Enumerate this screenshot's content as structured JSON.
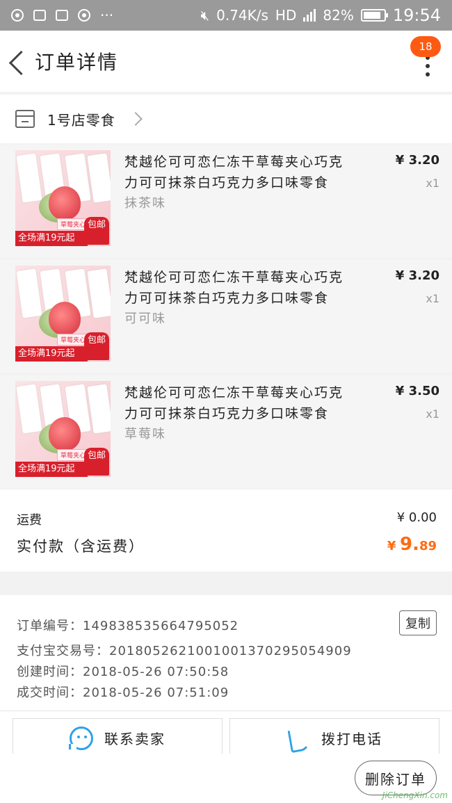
{
  "status_bar": {
    "network_speed": "0.74K/s",
    "network_type": "HD",
    "battery_pct": "82%",
    "time": "19:54"
  },
  "header": {
    "title": "订单详情",
    "badge_count": "18"
  },
  "store": {
    "name": "1号店零食"
  },
  "items": [
    {
      "title": "梵越伦可可恋仁冻干草莓夹心巧克力可可抹茶白巧克力多口味零食",
      "variant": "抹茶味",
      "price": "¥ 3.20",
      "qty": "x1",
      "thumb_tag": "草莓夹心巧克力",
      "thumb_promo": "全场满19元起",
      "thumb_ship": "包邮"
    },
    {
      "title": "梵越伦可可恋仁冻干草莓夹心巧克力可可抹茶白巧克力多口味零食",
      "variant": "可可味",
      "price": "¥ 3.20",
      "qty": "x1",
      "thumb_tag": "草莓夹心巧克力",
      "thumb_promo": "全场满19元起",
      "thumb_ship": "包邮"
    },
    {
      "title": "梵越伦可可恋仁冻干草莓夹心巧克力可可抹茶白巧克力多口味零食",
      "variant": "草莓味",
      "price": "¥ 3.50",
      "qty": "x1",
      "thumb_tag": "草莓夹心巧克力",
      "thumb_promo": "全场满19元起",
      "thumb_ship": "包邮"
    }
  ],
  "totals": {
    "shipping_label": "运费",
    "shipping_value": "¥ 0.00",
    "paid_label": "实付款（含运费）",
    "paid_currency": "¥",
    "paid_int": "9.",
    "paid_dec": "89"
  },
  "order_info": {
    "order_no": "订单编号：149838535664795052",
    "alipay_no": "支付宝交易号：2018052621001001370295054909",
    "created": "创建时间：2018-05-26 07:50:58",
    "completed": "成交时间：2018-05-26 07:51:09",
    "copy_label": "复制"
  },
  "actions": {
    "contact_seller": "联系卖家",
    "call_phone": "拨打电话",
    "delete_order": "删除订单"
  },
  "watermark": "JiChengXin.com",
  "colors": {
    "accent_orange": "#ff6a12",
    "badge": "#ff5a12",
    "icon_blue": "#2ea2e8"
  }
}
